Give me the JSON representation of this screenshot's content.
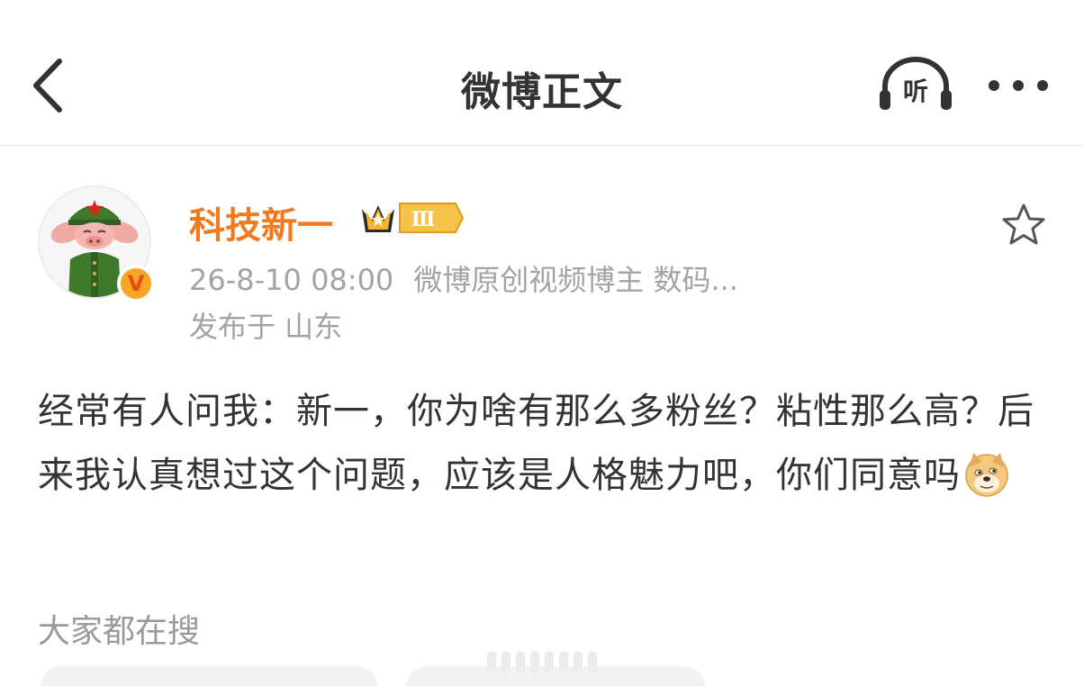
{
  "header": {
    "title": "微博正文",
    "listen_label": "听"
  },
  "author": {
    "name": "科技新一",
    "member_level": "Ⅲ",
    "verified_mark": "V",
    "time": "26-8-10 08:00",
    "source": "微博原创视频博主 数码...",
    "location": "发布于 山东"
  },
  "post": {
    "text": "经常有人问我：新一，你为啥有那么多粉丝？粘性那么高？后来我认真想过这个问题，应该是人格魅力吧，你们同意吗",
    "emoji_name": "doge-emoji"
  },
  "trending": {
    "title": "大家都在搜"
  },
  "colors": {
    "name_orange": "#f07a1f",
    "meta_gray": "#a3a3a3",
    "badge_gold": "#f5a623"
  },
  "icons": [
    "back-chevron-icon",
    "headphones-icon",
    "more-dots-icon",
    "star-outline-icon",
    "crown-icon"
  ]
}
